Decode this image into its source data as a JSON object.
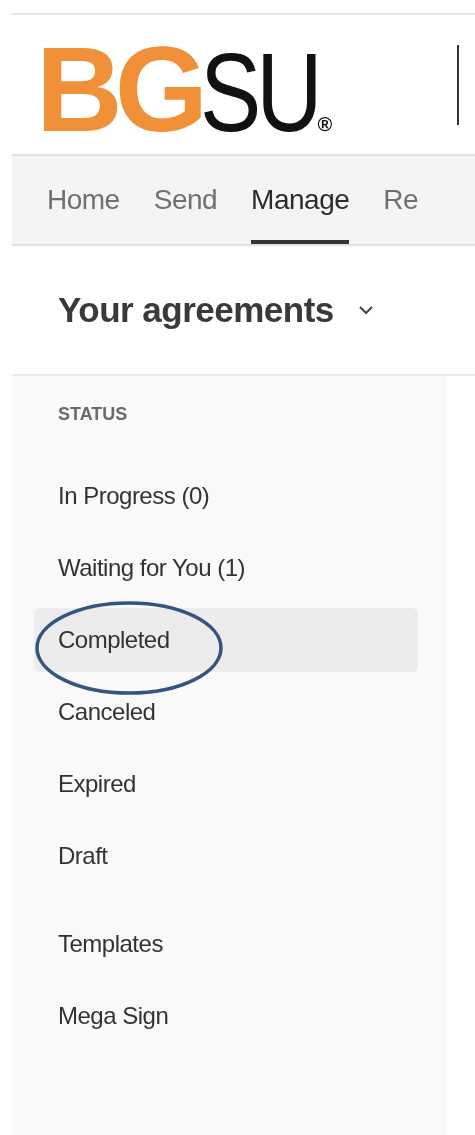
{
  "logo": {
    "bold_part": "BG",
    "light_part": "SU",
    "mark": "®"
  },
  "nav": [
    {
      "label": "Home",
      "selected": false
    },
    {
      "label": "Send",
      "selected": false
    },
    {
      "label": "Manage",
      "selected": true
    },
    {
      "label": "Re",
      "selected": false
    }
  ],
  "heading": {
    "title": "Your agreements",
    "expanded": false
  },
  "sidebar": {
    "sections": [
      {
        "heading": "STATUS",
        "items": [
          {
            "label": "In Progress (0)",
            "selected": false
          },
          {
            "label": "Waiting for You (1)",
            "selected": false
          },
          {
            "label": "Completed",
            "selected": true
          },
          {
            "label": "Canceled",
            "selected": false
          },
          {
            "label": "Expired",
            "selected": false
          },
          {
            "label": "Draft",
            "selected": false
          }
        ]
      },
      {
        "items": [
          {
            "label": "Templates",
            "selected": false
          },
          {
            "label": "Mega Sign",
            "selected": false
          }
        ]
      }
    ]
  }
}
